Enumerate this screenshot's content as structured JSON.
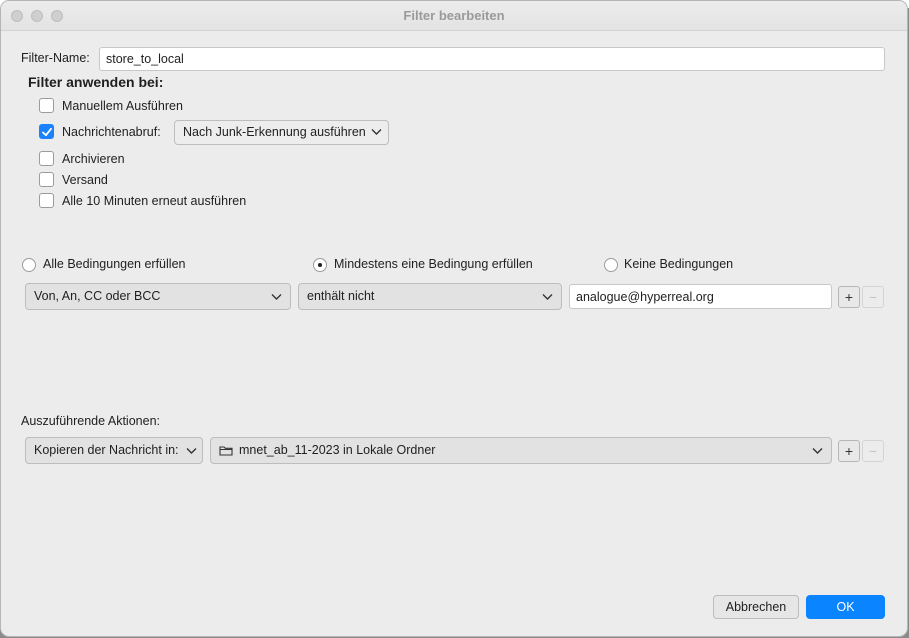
{
  "window": {
    "title": "Filter bearbeiten"
  },
  "filter_name": {
    "label": "Filter-Name:",
    "value": "store_to_local"
  },
  "apply_section": {
    "heading": "Filter anwenden bei:",
    "manual": {
      "label": "Manuellem Ausführen",
      "checked": false
    },
    "fetch": {
      "label": "Nachrichtenabruf:",
      "checked": true,
      "select_value": "Nach Junk-Erkennung ausführen"
    },
    "archive": {
      "label": "Archivieren",
      "checked": false
    },
    "send": {
      "label": "Versand",
      "checked": false
    },
    "periodic": {
      "label": "Alle 10 Minuten erneut ausführen",
      "checked": false
    }
  },
  "conditions": {
    "options": [
      {
        "label": "Alle Bedingungen erfüllen",
        "selected": false
      },
      {
        "label": "Mindestens eine Bedingung erfüllen",
        "selected": true
      },
      {
        "label": "Keine Bedingungen",
        "selected": false
      }
    ],
    "rule": {
      "field": "Von, An, CC oder BCC",
      "operator": "enthält nicht",
      "value": "analogue@hyperreal.org"
    },
    "add_label": "+",
    "remove_label": "−"
  },
  "actions": {
    "label": "Auszuführende Aktionen:",
    "action": "Kopieren der Nachricht in:",
    "target": "mnet_ab_11-2023 in Lokale Ordner",
    "add_label": "+",
    "remove_label": "−"
  },
  "buttons": {
    "cancel": "Abbrechen",
    "ok": "OK"
  },
  "colors": {
    "accent": "#0a84ff",
    "checkbox_checked": "#1a82fb"
  }
}
